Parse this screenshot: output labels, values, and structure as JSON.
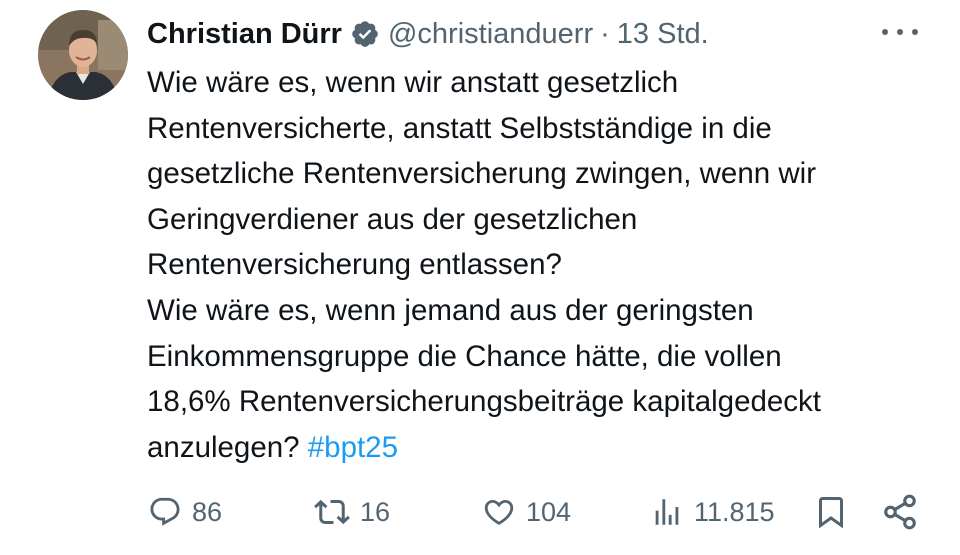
{
  "author": {
    "display_name": "Christian Dürr",
    "handle": "@christianduerr",
    "separator": "·",
    "timestamp": "13 Std.",
    "verified": true,
    "avatar_icon": "profile-photo"
  },
  "more_icon": "more-horizontal-icon",
  "tweet": {
    "lines": [
      "Wie wäre es, wenn wir anstatt gesetzlich",
      "Rentenversicherte, anstatt Selbstständige in die",
      "gesetzliche Rentenversicherung zwingen, wenn wir",
      "Geringverdiener aus der gesetzlichen",
      "Rentenversicherung entlassen?",
      "Wie wäre es, wenn jemand aus der geringsten",
      "Einkommensgruppe die Chance hätte, die vollen",
      "18,6% Rentenversicherungsbeiträge kapitalgedeckt"
    ],
    "last_line_text": "anzulegen? ",
    "hashtag": "#bpt25"
  },
  "actions": {
    "reply": {
      "icon": "reply-icon",
      "count": "86"
    },
    "repost": {
      "icon": "repost-icon",
      "count": "16"
    },
    "like": {
      "icon": "heart-icon",
      "count": "104"
    },
    "views": {
      "icon": "views-icon",
      "count": "11.815"
    },
    "bookmark": {
      "icon": "bookmark-icon"
    },
    "share": {
      "icon": "share-icon"
    }
  },
  "colors": {
    "text": "#0f1419",
    "secondary": "#536471",
    "link": "#1d9bf0"
  }
}
